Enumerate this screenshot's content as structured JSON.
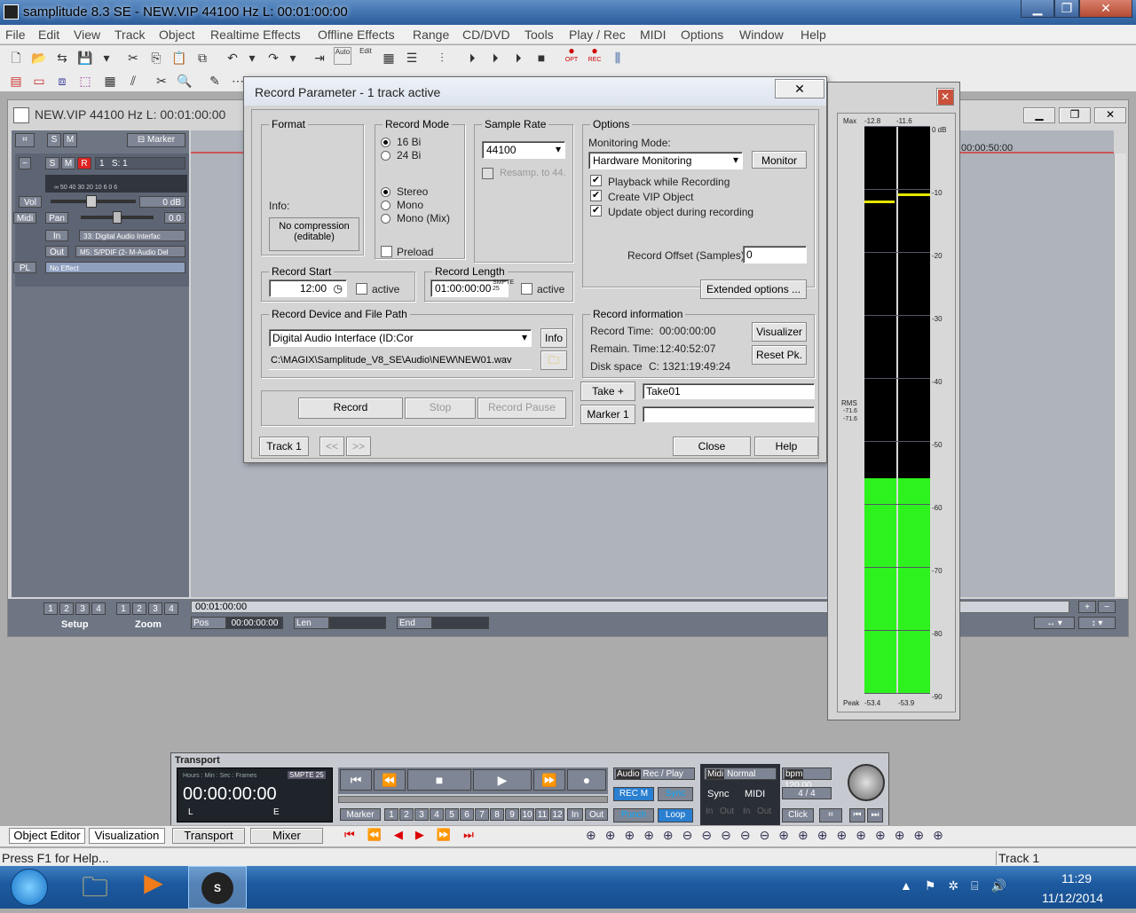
{
  "window": {
    "title": "samplitude 8.3 SE  - NEW.VIP   44100 Hz L: 00:01:00:00",
    "min": "▁",
    "max": "❐",
    "close": "✕"
  },
  "menu": [
    "File",
    "Edit",
    "View",
    "Track",
    "Object",
    "Realtime Effects",
    "Offline Effects",
    "Range",
    "CD/DVD",
    "Tools",
    "Play / Rec",
    "MIDI",
    "Options",
    "Window",
    "Help"
  ],
  "toolbar": {
    "auto": "Auto",
    "edit": "Edit",
    "opt": "OPT",
    "rec": "REC"
  },
  "project": {
    "title": "NEW.VIP    44100 Hz L: 00:01:00:00",
    "s": "S",
    "m": "M",
    "marker": "Marker",
    "track_s": "S",
    "track_m": "M",
    "track_r": "R",
    "track_num": "1",
    "track_sel": "S: 1",
    "scale": "∞ 50 40 30 20  10  6   0   6",
    "vol": "Vol",
    "vol_val": "0 dB",
    "midi": "Midi",
    "pan": "Pan",
    "pan_val": "0.0",
    "in": "In",
    "in_val": "33: Digital Audio Interfac",
    "out": "Out",
    "out_val": "M5: S/PDIF (2- M-Audio Del",
    "pl": "PL",
    "effect": "No Effect",
    "setup_nums": [
      "1",
      "2",
      "3",
      "4"
    ],
    "zoom_nums": [
      "1",
      "2",
      "3",
      "4"
    ],
    "setup": "Setup",
    "zoom": "Zoom",
    "time_marker": "00:00:50:00",
    "pos_label": "Pos",
    "pos_val": "00:00:00:00",
    "len_label": "Len",
    "end_label": "End",
    "ruler_time": "00:01:00:00"
  },
  "dialog": {
    "title": "Record Parameter - 1 track active",
    "format": "Format",
    "info": "Info:",
    "no_compression": "No compression\n(editable)",
    "record_mode": "Record Mode",
    "bits16": "16 Bi",
    "bits24": "24 Bi",
    "stereo": "Stereo",
    "mono": "Mono",
    "mono_mix": "Mono (Mix)",
    "preload": "Preload",
    "sample_rate": "Sample Rate",
    "rate_val": "44100",
    "resamp": "Resamp. to 44.",
    "options": "Options",
    "monitoring_mode": "Monitoring Mode:",
    "monitoring_val": "Hardware Monitoring",
    "monitor_btn": "Monitor",
    "playback": "Playback while Recording",
    "create_vip": "Create VIP Object",
    "update_obj": "Update object during recording",
    "record_offset": "Record Offset (Samples) :",
    "offset_val": "0",
    "extended": "Extended options ...",
    "record_start": "Record Start",
    "start_val": "12:00",
    "active": "active",
    "record_length": "Record Length",
    "length_val": "01:00:00:00",
    "smpte": "SMPTE 25",
    "active2": "active",
    "device_path": "Record Device and File Path",
    "device_val": "Digital Audio Interface (ID:Cor",
    "info_btn": "Info",
    "path_val": "C:\\MAGIX\\Samplitude_V8_SE\\Audio\\NEW\\NEW01.wav",
    "rec_info": "Record information",
    "rec_time_l": "Record Time:",
    "rec_time": "00:00:00:00",
    "remain_l": "Remain. Time:",
    "remain": "12:40:52:07",
    "disk_l": "Disk space",
    "disk": "C: 1321:19:49:24",
    "visualizer": "Visualizer",
    "reset_pk": "Reset Pk.",
    "take_btn": "Take +",
    "take_val": "Take01",
    "marker_btn": "Marker 1",
    "record": "Record",
    "stop": "Stop",
    "record_pause": "Record Pause",
    "track": "Track 1",
    "prev": "<<",
    "next": ">>",
    "close": "Close",
    "help": "Help"
  },
  "meter": {
    "max": "Max",
    "left_max": "-12.8",
    "right_max": "-11.6",
    "scale": [
      "0 dB",
      "-10",
      "-20",
      "-30",
      "-40",
      "-50",
      "-60",
      "-70",
      "-80",
      "-90"
    ],
    "rms": "RMS",
    "rms_l": "-71.6",
    "rms_r": "-71.6",
    "peak": "Peak",
    "peak_l": "-53.4",
    "peak_r": "-53.9",
    "level_fraction": 0.38
  },
  "transport": {
    "title": "Transport",
    "header": "Hours : Min : Sec : Frames",
    "smpte": "SMPTE 25",
    "time": "00:00:00:00",
    "l": "L",
    "e": "E",
    "audio": "Audio",
    "recplay": "Rec / Play",
    "recm": "REC M",
    "sync": "Sync",
    "punch": "Punch",
    "loop": "Loop",
    "marker": "Marker",
    "nums": [
      "1",
      "2",
      "3",
      "4",
      "5",
      "6",
      "7",
      "8",
      "9",
      "10",
      "11",
      "12"
    ],
    "in": "In",
    "out": "Out",
    "midi": "Midi",
    "normal": "Normal",
    "sync2": "Sync",
    "midi2": "MIDI",
    "in2": "In",
    "out2": "Out",
    "in3": "In",
    "out3": "Out",
    "bpm": "bpm",
    "bpm_val": "120.00",
    "sig": "4 / 4",
    "click": "Click"
  },
  "bottom_tabs": [
    "Object Editor",
    "Visualization",
    "Transport",
    "Mixer"
  ],
  "status": {
    "help": "Press F1 for Help...",
    "track": "Track 1"
  },
  "taskbar": {
    "time": "11:29",
    "date": "11/12/2014"
  }
}
